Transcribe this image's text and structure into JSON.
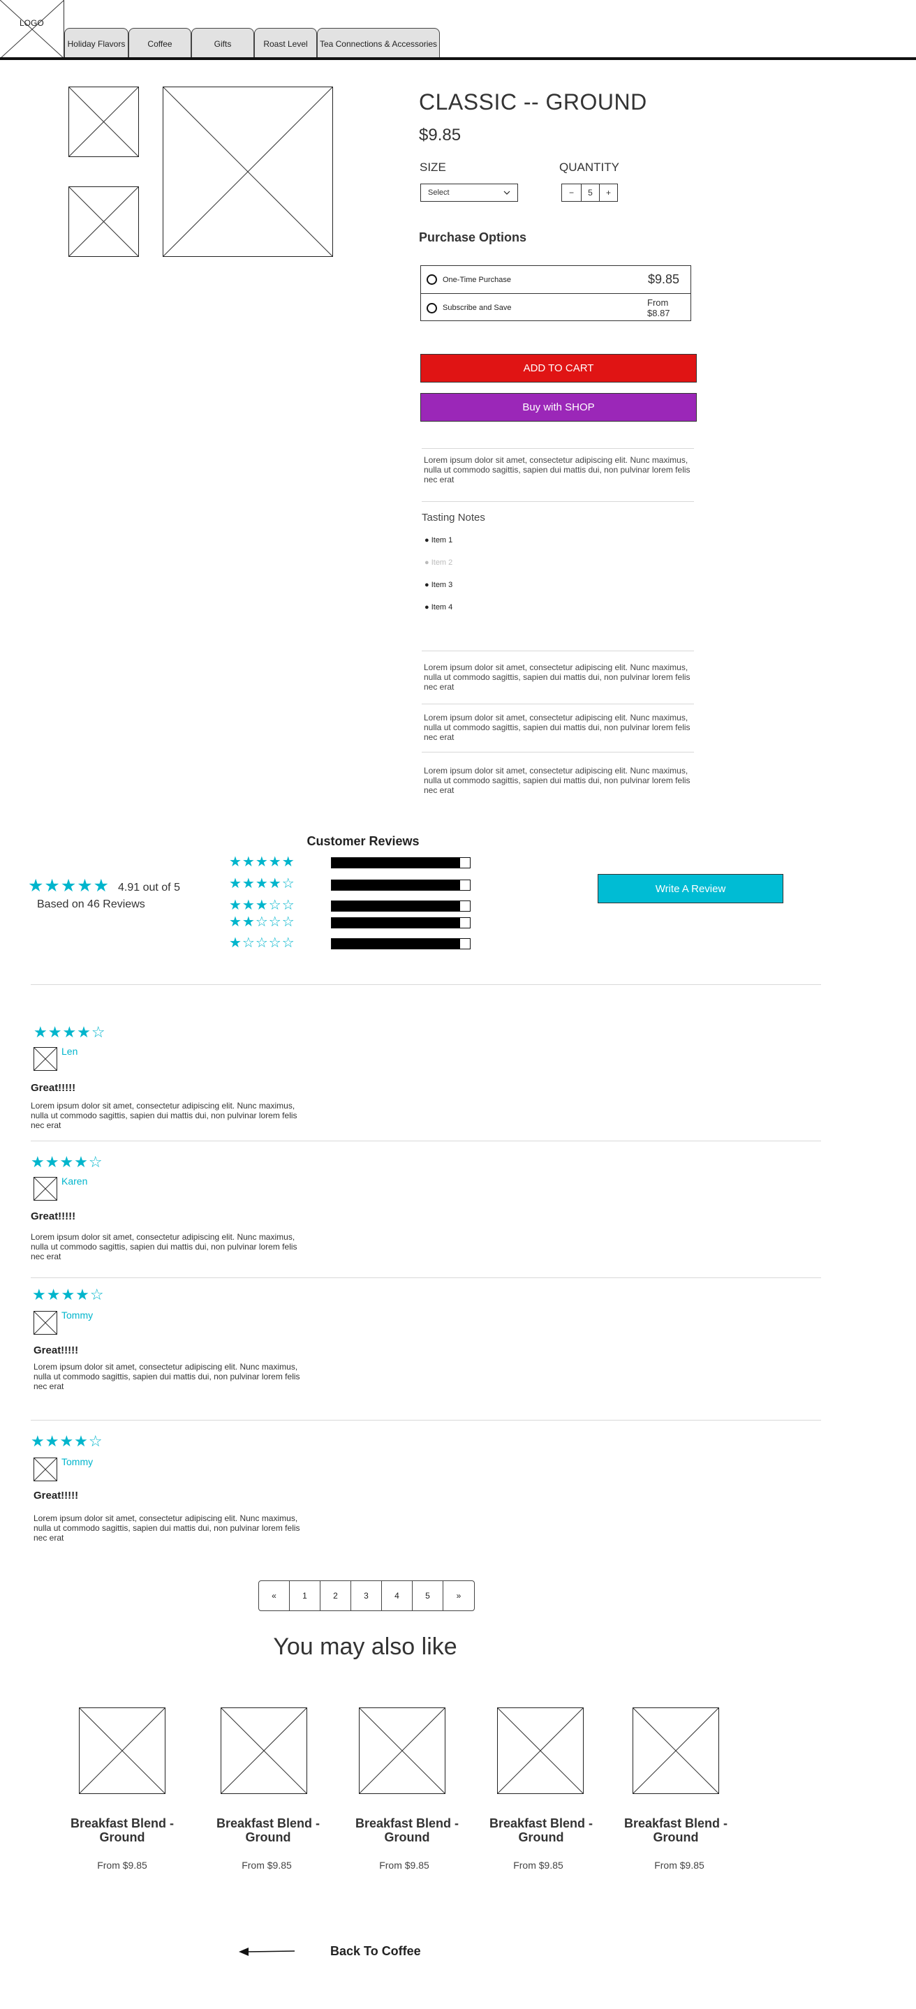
{
  "nav": {
    "logo": "LOGO",
    "tabs": [
      "Holiday Flavors",
      "Coffee",
      "Gifts",
      "Roast Level",
      "Tea Connections & Accessories"
    ]
  },
  "product": {
    "title": "CLASSIC -- GROUND",
    "price": "$9.85",
    "size_label": "SIZE",
    "size_value": "Select",
    "quantity_label": "QUANTITY",
    "quantity_minus": "−",
    "quantity_value": "5",
    "quantity_plus": "+",
    "purchase_options_title": "Purchase Options",
    "options": [
      {
        "label": "One-Time Purchase",
        "price": "$9.85"
      },
      {
        "label": "Subscribe and Save",
        "price": "From $8.87"
      }
    ],
    "add_to_cart": "ADD TO CART",
    "buy_shop": "Buy with SHOP",
    "description": "Lorem ipsum dolor sit amet, consectetur adipiscing elit. Nunc maximus, nulla ut commodo sagittis, sapien dui mattis dui, non pulvinar lorem felis nec erat",
    "tasting_notes_title": "Tasting Notes",
    "tasting_notes": [
      "Item 1",
      "Item 2",
      "Item 3",
      "Item 4"
    ],
    "extra_paragraphs": [
      "Lorem ipsum dolor sit amet, consectetur adipiscing elit. Nunc maximus, nulla ut commodo sagittis, sapien dui mattis dui, non pulvinar lorem felis nec erat",
      "Lorem ipsum dolor sit amet, consectetur adipiscing elit. Nunc maximus, nulla ut commodo sagittis, sapien dui mattis dui, non pulvinar lorem felis nec erat",
      "Lorem ipsum dolor sit amet, consectetur adipiscing elit. Nunc maximus, nulla ut commodo sagittis, sapien dui mattis dui, non pulvinar lorem felis nec erat"
    ]
  },
  "reviews_summary": {
    "title": "Customer Reviews",
    "average": "4.91 out of 5",
    "average_stars": 5,
    "based_on": "Based on 46 Reviews",
    "distribution": [
      {
        "stars": 5,
        "fill": 0.93
      },
      {
        "stars": 4,
        "fill": 0.93
      },
      {
        "stars": 3,
        "fill": 0.93
      },
      {
        "stars": 2,
        "fill": 0.93
      },
      {
        "stars": 1,
        "fill": 0.93
      }
    ],
    "write_review": "Write A Review"
  },
  "reviews": [
    {
      "rating": 4,
      "name": "Len",
      "headline": "Great!!!!!",
      "body": "Lorem ipsum dolor sit amet, consectetur adipiscing elit. Nunc maximus, nulla ut commodo sagittis, sapien dui mattis dui, non pulvinar lorem felis nec erat"
    },
    {
      "rating": 4,
      "name": "Karen",
      "headline": "Great!!!!!",
      "body": "Lorem ipsum dolor sit amet, consectetur adipiscing elit. Nunc maximus, nulla ut commodo sagittis, sapien dui mattis dui, non pulvinar lorem felis nec erat"
    },
    {
      "rating": 4,
      "name": "Tommy",
      "headline": "Great!!!!!",
      "body": "Lorem ipsum dolor sit amet, consectetur adipiscing elit. Nunc maximus, nulla ut commodo sagittis, sapien dui mattis dui, non pulvinar lorem felis nec erat"
    },
    {
      "rating": 4,
      "name": "Tommy",
      "headline": "Great!!!!!",
      "body": "Lorem ipsum dolor sit amet, consectetur adipiscing elit. Nunc maximus, nulla ut commodo sagittis, sapien dui mattis dui, non pulvinar lorem felis nec erat"
    }
  ],
  "pagination": [
    "«",
    "1",
    "2",
    "3",
    "4",
    "5",
    "»"
  ],
  "recommendations": {
    "title": "You may also like",
    "items": [
      {
        "name": "Breakfast Blend - Ground",
        "price": "From $9.85"
      },
      {
        "name": "Breakfast Blend - Ground",
        "price": "From $9.85"
      },
      {
        "name": "Breakfast Blend - Ground",
        "price": "From $9.85"
      },
      {
        "name": "Breakfast Blend - Ground",
        "price": "From $9.85"
      },
      {
        "name": "Breakfast Blend - Ground",
        "price": "From $9.85"
      }
    ]
  },
  "back_link": "Back To Coffee",
  "colors": {
    "accent": "#00b5cc",
    "cart_button": "#e01414",
    "shop_button": "#9b27b8",
    "review_button": "#00bcd4"
  }
}
